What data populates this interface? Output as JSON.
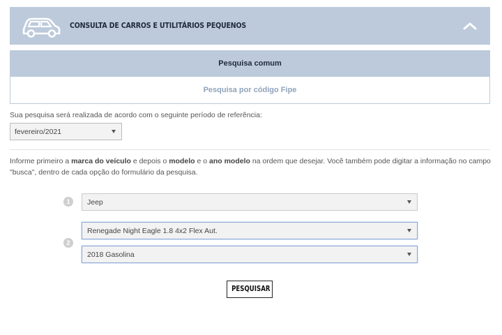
{
  "header": {
    "title": "Consulta de Carros e Utilitários Pequenos",
    "icon": "car-icon",
    "toggle_icon": "chevron-up-icon",
    "bg_color": "#bccadb"
  },
  "tabs": [
    {
      "label": "Pesquisa comum",
      "active": true
    },
    {
      "label": "Pesquisa por código Fipe",
      "active": false
    }
  ],
  "reference": {
    "label": "Sua pesquisa será realizada de acordo com o seguinte período de referência:",
    "selected": "fevereiro/2021"
  },
  "instructions": {
    "p1": "Informe primeiro a ",
    "b1": "marca do veículo",
    "p2": " e depois o ",
    "b2": "modelo",
    "p3": " e o ",
    "b3": "ano modelo",
    "p4": " na ordem que desejar. Você também pode digitar a informação no campo \"busca\", dentro de cada opção do formulário da pesquisa."
  },
  "steps": [
    "1",
    "2"
  ],
  "form": {
    "brand": "Jeep",
    "model": "Renegade Night Eagle 1.8 4x2 Flex Aut.",
    "year": "2018 Gasolina"
  },
  "search_button": "PESQUISAR"
}
